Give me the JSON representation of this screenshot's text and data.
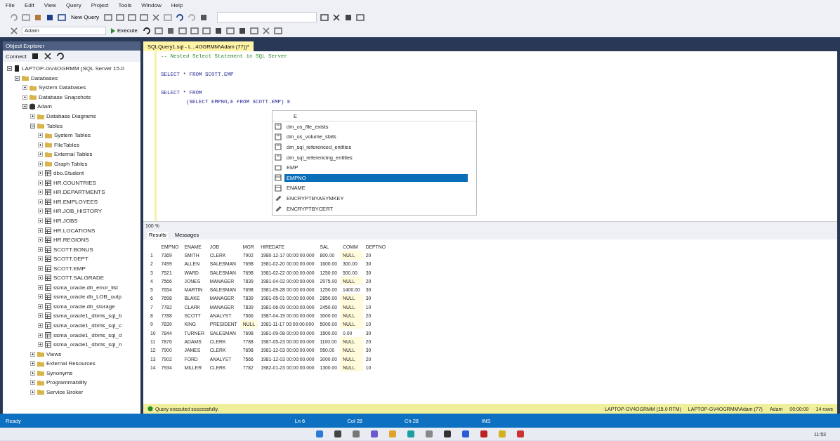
{
  "menu": [
    "File",
    "Edit",
    "View",
    "Query",
    "Project",
    "Tools",
    "Window",
    "Help"
  ],
  "toolbar": {
    "new_query": "New Query",
    "database": "Adam",
    "execute": "Execute"
  },
  "object_explorer": {
    "title": "Object Explorer",
    "connect": "Connect",
    "tree": [
      {
        "label": "LAPTOP-GV4OGRMM (SQL Server 15.0",
        "kind": "server",
        "expanded": true,
        "children": [
          {
            "label": "Databases",
            "kind": "folder",
            "expanded": true,
            "children": [
              {
                "label": "System Databases",
                "kind": "folder",
                "expanded": false
              },
              {
                "label": "Database Snapshots",
                "kind": "folder",
                "expanded": false
              },
              {
                "label": "Adam",
                "kind": "database",
                "expanded": true,
                "children": [
                  {
                    "label": "Database Diagrams",
                    "kind": "folder",
                    "expanded": false
                  },
                  {
                    "label": "Tables",
                    "kind": "folder",
                    "expanded": true,
                    "children": [
                      {
                        "label": "System Tables",
                        "kind": "folder",
                        "expanded": false
                      },
                      {
                        "label": "FileTables",
                        "kind": "folder",
                        "expanded": false
                      },
                      {
                        "label": "External Tables",
                        "kind": "folder",
                        "expanded": false
                      },
                      {
                        "label": "Graph Tables",
                        "kind": "folder",
                        "expanded": false
                      },
                      {
                        "label": "dbo.Student",
                        "kind": "table",
                        "expanded": false
                      },
                      {
                        "label": "HR.COUNTRIES",
                        "kind": "table",
                        "expanded": false
                      },
                      {
                        "label": "HR.DEPARTMENTS",
                        "kind": "table",
                        "expanded": false
                      },
                      {
                        "label": "HR.EMPLOYEES",
                        "kind": "table",
                        "expanded": false
                      },
                      {
                        "label": "HR.JOB_HISTORY",
                        "kind": "table",
                        "expanded": false
                      },
                      {
                        "label": "HR.JOBS",
                        "kind": "table",
                        "expanded": false
                      },
                      {
                        "label": "HR.LOCATIONS",
                        "kind": "table",
                        "expanded": false
                      },
                      {
                        "label": "HR.REGIONS",
                        "kind": "table",
                        "expanded": false
                      },
                      {
                        "label": "SCOTT.BONUS",
                        "kind": "table",
                        "expanded": false
                      },
                      {
                        "label": "SCOTT.DEPT",
                        "kind": "table",
                        "expanded": false
                      },
                      {
                        "label": "SCOTT.EMP",
                        "kind": "table",
                        "expanded": false
                      },
                      {
                        "label": "SCOTT.SALGRADE",
                        "kind": "table",
                        "expanded": false
                      },
                      {
                        "label": "ssma_oracle.db_error_list",
                        "kind": "table",
                        "expanded": false
                      },
                      {
                        "label": "ssma_oracle.db_LOB_outp",
                        "kind": "table",
                        "expanded": false
                      },
                      {
                        "label": "ssma_oracle.db_storage",
                        "kind": "table",
                        "expanded": false
                      },
                      {
                        "label": "ssma_oracle1_dbms_sql_b",
                        "kind": "table",
                        "expanded": false
                      },
                      {
                        "label": "ssma_oracle1_dbms_sql_c",
                        "kind": "table",
                        "expanded": false
                      },
                      {
                        "label": "ssma_oracle1_dbms_sql_d",
                        "kind": "table",
                        "expanded": false
                      },
                      {
                        "label": "ssma_oracle1_dbms_sql_n",
                        "kind": "table",
                        "expanded": false
                      }
                    ]
                  },
                  {
                    "label": "Views",
                    "kind": "folder",
                    "expanded": false
                  },
                  {
                    "label": "External Resources",
                    "kind": "folder",
                    "expanded": false
                  },
                  {
                    "label": "Synonyms",
                    "kind": "folder",
                    "expanded": false
                  },
                  {
                    "label": "Programmability",
                    "kind": "folder",
                    "expanded": false
                  },
                  {
                    "label": "Service Broker",
                    "kind": "folder",
                    "expanded": false
                  }
                ]
              }
            ]
          }
        ]
      }
    ]
  },
  "editor": {
    "tab": "SQLQuery1.sql - L...4OGRMM\\Adam (77))*",
    "lines": [
      {
        "text": "-- Nested Select Statement in SQL Server",
        "kind": "comment"
      },
      {
        "kind": "blank"
      },
      {
        "text": "SELECT * FROM SCOTT.EMP",
        "kind": "code"
      },
      {
        "kind": "blank"
      },
      {
        "text": "SELECT * FROM",
        "kind": "code"
      },
      {
        "text": "        (SELECT EMPNO,E FROM SCOTT.EMP) E",
        "kind": "code"
      }
    ],
    "completion": {
      "typed": "E",
      "items": [
        {
          "label": "dm_os_file_exists",
          "kind": "function",
          "selected": false
        },
        {
          "label": "dm_os_volume_stats",
          "kind": "function",
          "selected": false
        },
        {
          "label": "dm_sql_referenced_entities",
          "kind": "function",
          "selected": false
        },
        {
          "label": "dm_sql_referencing_entities",
          "kind": "function",
          "selected": false
        },
        {
          "label": "EMP",
          "kind": "table",
          "selected": false
        },
        {
          "label": "EMPNO",
          "kind": "column",
          "selected": true
        },
        {
          "label": "ENAME",
          "kind": "column",
          "selected": false
        },
        {
          "label": "ENCRYPTBYASYMKEY",
          "kind": "builtin",
          "selected": false
        },
        {
          "label": "ENCRYPTBYCERT",
          "kind": "builtin",
          "selected": false
        }
      ]
    },
    "zoom": "100 %"
  },
  "results": {
    "tabs": [
      {
        "label": "Results",
        "selected": true
      },
      {
        "label": "Messages",
        "selected": false
      }
    ],
    "columns": [
      "",
      "EMPNO",
      "ENAME",
      "JOB",
      "MGR",
      "HIREDATE",
      "SAL",
      "COMM",
      "DEPTNO"
    ],
    "rows": [
      [
        "1",
        "7369",
        "SMITH",
        "CLERK",
        "7902",
        "1980-12-17 00:00:00.000",
        "800.00",
        "NULL",
        "20"
      ],
      [
        "2",
        "7499",
        "ALLEN",
        "SALESMAN",
        "7698",
        "1981-02-20 00:00:00.000",
        "1600.00",
        "300.00",
        "30"
      ],
      [
        "3",
        "7521",
        "WARD",
        "SALESMAN",
        "7698",
        "1981-02-22 00:00:00.000",
        "1250.00",
        "500.00",
        "30"
      ],
      [
        "4",
        "7566",
        "JONES",
        "MANAGER",
        "7839",
        "1981-04-02 00:00:00.000",
        "2975.00",
        "NULL",
        "20"
      ],
      [
        "5",
        "7654",
        "MARTIN",
        "SALESMAN",
        "7698",
        "1981-09-28 00:00:00.000",
        "1250.00",
        "1400.00",
        "30"
      ],
      [
        "6",
        "7698",
        "BLAKE",
        "MANAGER",
        "7839",
        "1981-05-01 00:00:00.000",
        "2850.00",
        "NULL",
        "30"
      ],
      [
        "7",
        "7782",
        "CLARK",
        "MANAGER",
        "7839",
        "1981-06-09 00:00:00.000",
        "2450.00",
        "NULL",
        "10"
      ],
      [
        "8",
        "7788",
        "SCOTT",
        "ANALYST",
        "7566",
        "1987-04-19 00:00:00.000",
        "3000.00",
        "NULL",
        "20"
      ],
      [
        "9",
        "7839",
        "KING",
        "PRESIDENT",
        "NULL",
        "1981-11-17 00:00:00.000",
        "5000.00",
        "NULL",
        "10"
      ],
      [
        "10",
        "7844",
        "TURNER",
        "SALESMAN",
        "7698",
        "1981-09-08 00:00:00.000",
        "1500.00",
        "0.00",
        "30"
      ],
      [
        "11",
        "7876",
        "ADAMS",
        "CLERK",
        "7788",
        "1987-05-23 00:00:00.000",
        "1100.00",
        "NULL",
        "20"
      ],
      [
        "12",
        "7900",
        "JAMES",
        "CLERK",
        "7698",
        "1981-12-03 00:00:00.000",
        "950.00",
        "NULL",
        "30"
      ],
      [
        "13",
        "7902",
        "FORD",
        "ANALYST",
        "7566",
        "1981-12-03 00:00:00.000",
        "3000.00",
        "NULL",
        "20"
      ],
      [
        "14",
        "7934",
        "MILLER",
        "CLERK",
        "7782",
        "1982-01-23 00:00:00.000",
        "1300.00",
        "NULL",
        "10"
      ]
    ],
    "status": "Query executed successfully.",
    "info": [
      "LAPTOP-GV4OGRMM (15.0 RTM)",
      "LAPTOP-GV4OGRMM\\Adam (77)",
      "Adam",
      "00:00:00",
      "14 rows"
    ]
  },
  "status_bar": {
    "state": "Ready",
    "position": [
      "Ln 6",
      "Col 28",
      "Ch 28"
    ],
    "mode": "INS"
  },
  "taskbar": {
    "time": "11:53"
  }
}
